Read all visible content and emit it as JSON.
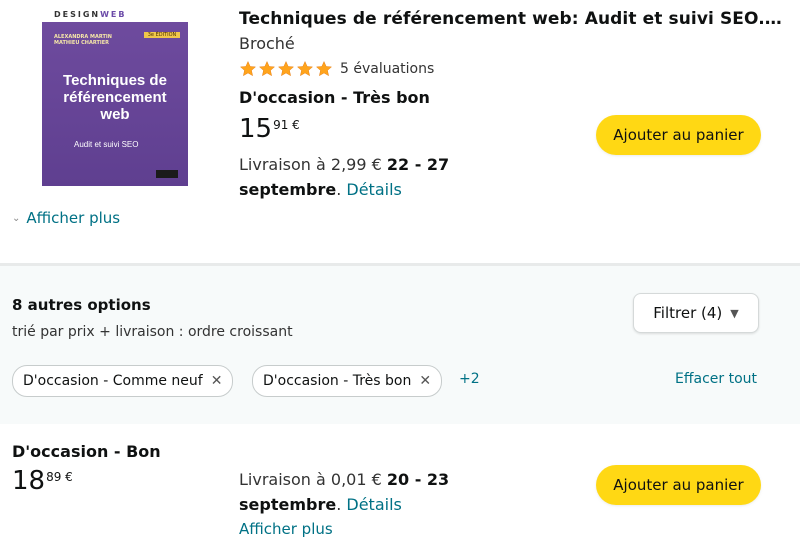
{
  "product": {
    "cover": {
      "brand_prefix": "DESIGN",
      "brand_suffix": "WEB",
      "edition_badge": "3e ÉDITION",
      "authors": "ALEXANDRA MARTIN\nMATHIEU CHARTIER",
      "title_line1": "Techniques de",
      "title_line2": "référencement",
      "title_line3": "web",
      "subtitle": "Audit et suivi SEO"
    },
    "title": "Techniques de référencement web: Audit et suivi SEO. P...",
    "format": "Broché",
    "rating_stars": 5,
    "rating_count_text": "5 évaluations",
    "condition": "D'occasion - Très bon",
    "price_whole": "15",
    "price_frac": "91 €",
    "delivery_prefix": "Livraison à 2,99 € ",
    "delivery_dates": "22 - 27 septembre",
    "delivery_link": "Détails",
    "add_to_cart": "Ajouter au panier"
  },
  "show_more": "Afficher plus",
  "options": {
    "count_title": "8 autres options",
    "sort_text": "trié par prix + livraison : ordre croissant",
    "filter_label": "Filtrer (4)",
    "chips": [
      {
        "label": "D'occasion - Comme neuf"
      },
      {
        "label": "D'occasion - Très bon"
      }
    ],
    "more_chips": "+2",
    "clear_all": "Effacer tout"
  },
  "offer2": {
    "condition": "D'occasion - Bon",
    "price_whole": "18",
    "price_frac": "89 €",
    "delivery_prefix": "Livraison à 0,01 € ",
    "delivery_dates": "20 - 23 septembre",
    "delivery_link": "Détails",
    "add_to_cart": "Ajouter au panier",
    "show_more": "Afficher plus"
  },
  "colors": {
    "cart_button": "#ffd814",
    "link": "#007185",
    "star": "#ffa41c",
    "band_bg": "#f7fafa"
  }
}
